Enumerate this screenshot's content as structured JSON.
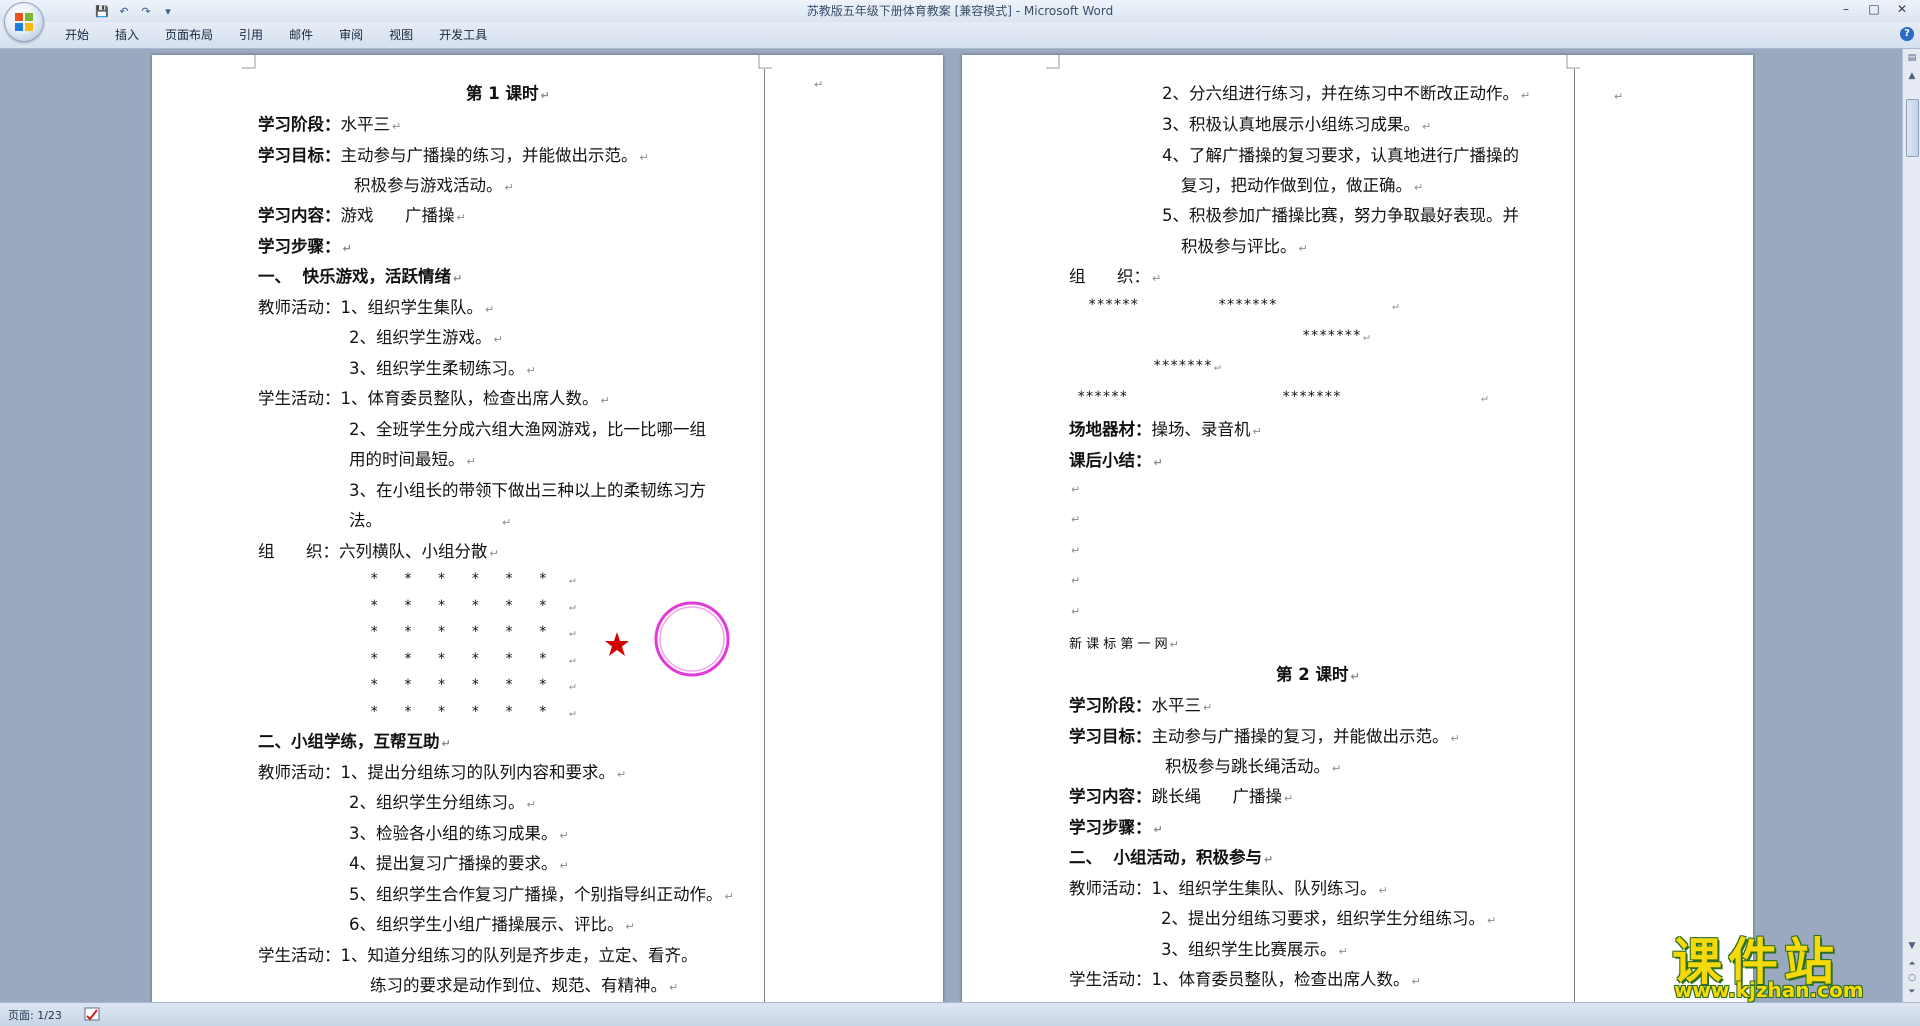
{
  "window": {
    "title": "苏教版五年级下册体育教案 [兼容模式] - Microsoft Word",
    "controls": [
      "–",
      "□",
      "✕"
    ]
  },
  "qat": {
    "save": "💾",
    "undo": "↶",
    "redo": "↷",
    "more": "▾"
  },
  "ribbon": {
    "tabs": [
      "开始",
      "插入",
      "页面布局",
      "引用",
      "邮件",
      "审阅",
      "视图",
      "开发工具"
    ],
    "help": "?"
  },
  "page1": {
    "title": "第 1 课时",
    "stage_label": "学习阶段：",
    "stage_value": "水平三",
    "goal_label": "学习目标：",
    "goal_1": "主动参与广播操的练习，并能做出示范。",
    "goal_2": "积极参与游戏活动。",
    "content_label": "学习内容：",
    "content_value": "游戏      广播操",
    "steps_label": "学习步骤：",
    "section1": "一、  快乐游戏，活跃情绪",
    "teacher_label": "教师活动：",
    "t1": "1、组织学生集队。",
    "t2": "2、组织学生游戏。",
    "t3": "3、组织学生柔韧练习。",
    "student_label": "学生活动：",
    "s1": "1、体育委员整队，检查出席人数。",
    "s2a": "2、全班学生分成六组大渔网游戏，比一比哪一组",
    "s2b": "用的时间最短。",
    "s3a": "3、在小组长的带领下做出三种以上的柔韧练习方",
    "s3b": "法。",
    "org_label": "组      织：",
    "org_value": "六列横队、小组分散",
    "star_row": "*   *   *   *   *   *",
    "section2": "二、小组学练，互帮互助",
    "teacher_label2": "教师活动：",
    "t21": "1、提出分组练习的队列内容和要求。",
    "t22": "2、组织学生分组练习。",
    "t23": "3、检验各小组的练习成果。",
    "t24": "4、提出复习广播操的要求。",
    "t25": "5、组织学生合作复习广播操，个别指导纠正动作。",
    "t26": "6、组织学生小组广播操展示、评比。",
    "student_label2": "学生活动：",
    "s21": "1、知道分组练习的队列是齐步走，立定、看齐。",
    "s22": "练习的要求是动作到位、规范、有精神。"
  },
  "page2": {
    "l1": "2、分六组进行练习，并在练习中不断改正动作。",
    "l2": "3、积极认真地展示小组练习成果。",
    "l3a": "4、了解广播操的复习要求，认真地进行广播操的",
    "l3b": "复习，把动作做到位，做正确。",
    "l4a": "5、积极参加广播操比赛，努力争取最好表现。并",
    "l4b": "积极参与评比。",
    "org_label": "组      织：",
    "r1a": "******",
    "r1b": "*******",
    "r2": "*******",
    "r3": "*******",
    "r4a": "******",
    "r4b": "*******",
    "equip_label": "场地器材：",
    "equip_value": "操场、录音机",
    "summary_label": "课后小结：",
    "site_note": "新 课 标 第 一 网",
    "title2": "第 2 课时",
    "stage_label": "学习阶段：",
    "stage_value": "水平三",
    "goal_label": "学习目标：",
    "goal_1": "主动参与广播操的复习，并能做出示范。",
    "goal_2": "积极参与跳长绳活动。",
    "content_label": "学习内容：",
    "content_value": "跳长绳      广播操",
    "steps_label": "学习步骤：",
    "section": "二、  小组活动，积极参与",
    "teacher_label": "教师活动：",
    "t1": "1、组织学生集队、队列练习。",
    "t2": "2、提出分组练习要求，组织学生分组练习。",
    "t3": "3、组织学生比赛展示。",
    "student_label": "学生活动：",
    "s1": "1、体育委员整队，检查出席人数。"
  },
  "return_mark": "↵",
  "status": {
    "page": "页面: 1/23"
  },
  "watermark": {
    "main": "课件站",
    "url": "www.kjzhan.com"
  },
  "colors": {
    "accent": "#2a6ac4",
    "star": "#d40000",
    "circle": "#e23ad8",
    "logo_text": "#f5d90a",
    "logo_outline": "#2d6e1d"
  }
}
